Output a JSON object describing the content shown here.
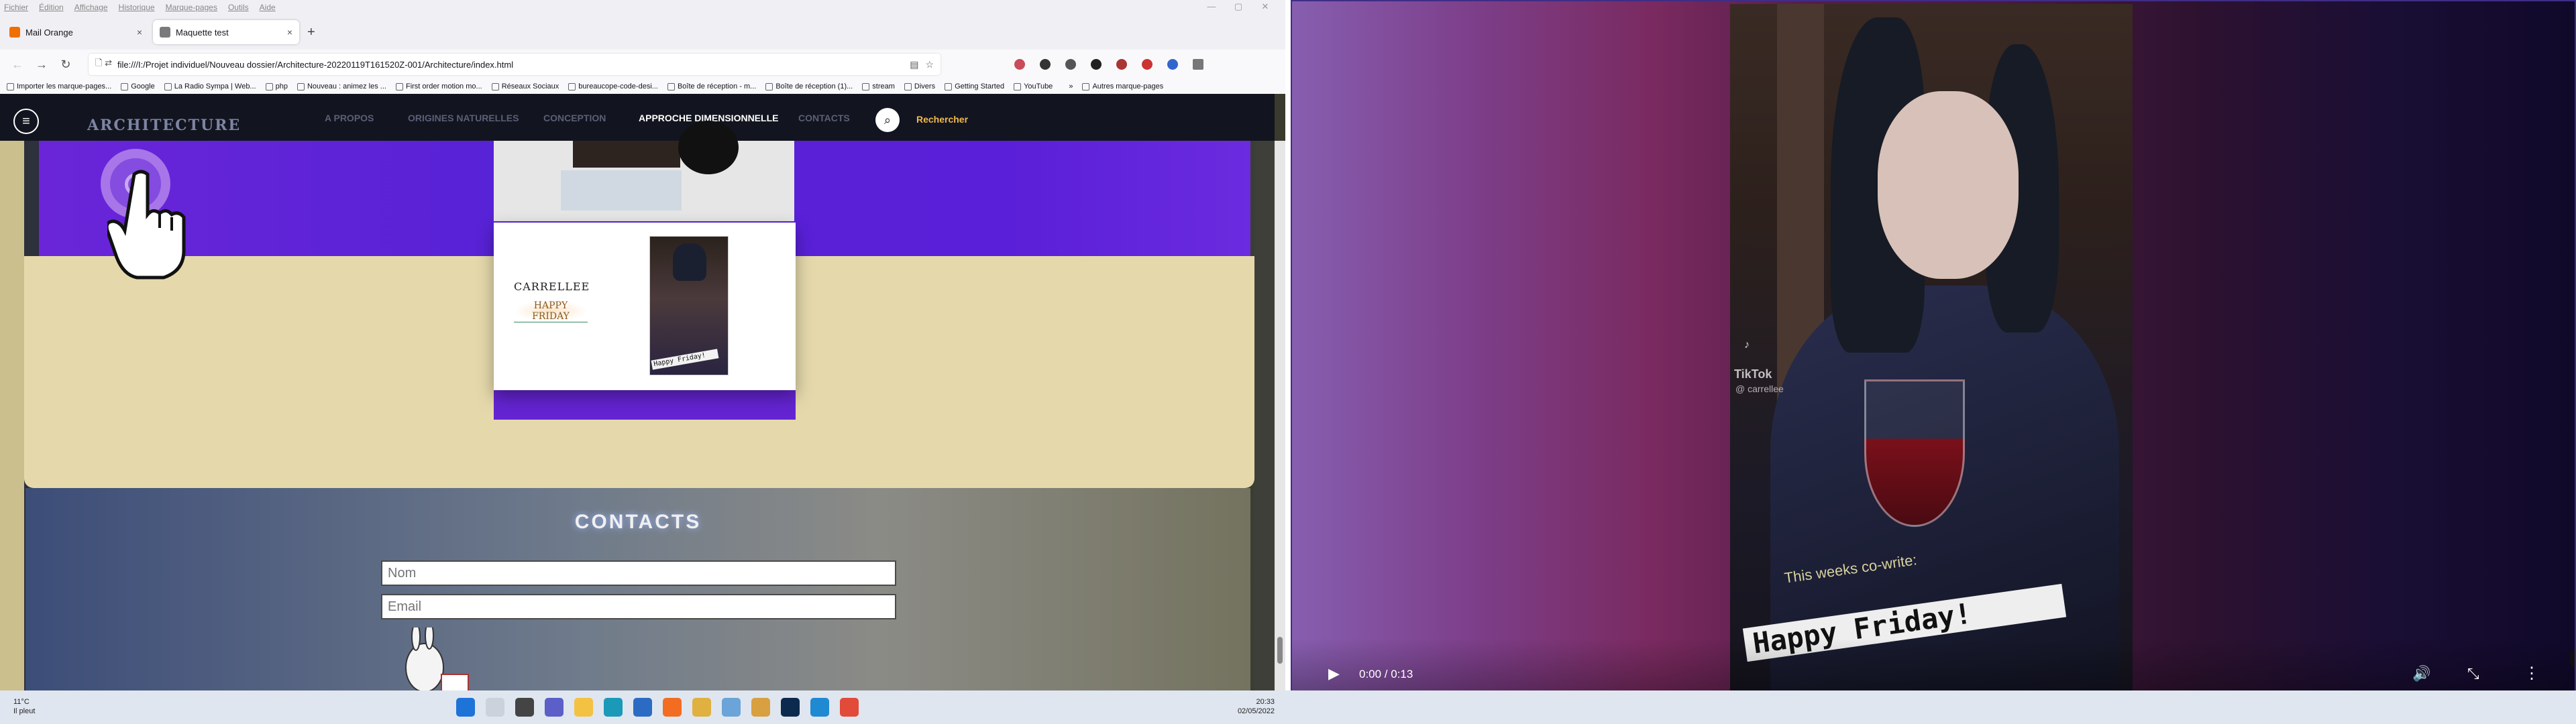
{
  "menubar": {
    "items": [
      "Fichier",
      "Édition",
      "Affichage",
      "Historique",
      "Marque-pages",
      "Outils",
      "Aide"
    ]
  },
  "tabs": [
    {
      "title": "Mail Orange",
      "close": "×",
      "color": "#f16e00"
    },
    {
      "title": "Maquette test",
      "close": "×",
      "color": "#7a7a7a"
    }
  ],
  "newtab_label": "+",
  "url": "file:///I:/Projet individuel/Nouveau dossier/Architecture-20220119T161520Z-001/Architecture/index.html",
  "bookmarks": [
    "Importer les marque-pages...",
    "Google",
    "La Radio Sympa | Web...",
    "php",
    "Nouveau : animez les ...",
    "First order motion mo...",
    "Réseaux Sociaux",
    "bureaucope-code-desi...",
    "Boîte de réception - m...",
    "Boîte de réception (1)...",
    "stream",
    "Divers",
    "Getting Started",
    "YouTube",
    "Autres marque-pages"
  ],
  "site": {
    "logo": "ARCHITECTURE",
    "nav": [
      "A PROPOS",
      "ORIGINES NATURELLES",
      "CONCEPTION",
      "APPROCHE DIMENSIONNELLE",
      "CONTACTS"
    ],
    "active_nav": "APPROCHE DIMENSIONNELLE",
    "search_label": "Rechercher",
    "card": {
      "name": "CARRELLEE",
      "subtitle": "HAPPY FRIDAY",
      "photo_caption": "Happy Friday!"
    },
    "contacts": {
      "title": "CONTACTS",
      "name_placeholder": "Nom",
      "email_placeholder": "Email"
    }
  },
  "video": {
    "tiktok": "TikTok",
    "user": "@ carrellee",
    "cowrite": "This weeks co-write:",
    "happy": "Happy Friday!",
    "time": "0:00 / 0:13",
    "progress_fraction": 0.06
  },
  "taskbar": {
    "temp": "11°C",
    "weather": "Il pleut",
    "time": "20:33",
    "date": "02/05/2022"
  },
  "colors": {
    "accent_purple": "#5a22d6",
    "beige": "#e5d9ac",
    "search_label": "#f2b94e"
  }
}
